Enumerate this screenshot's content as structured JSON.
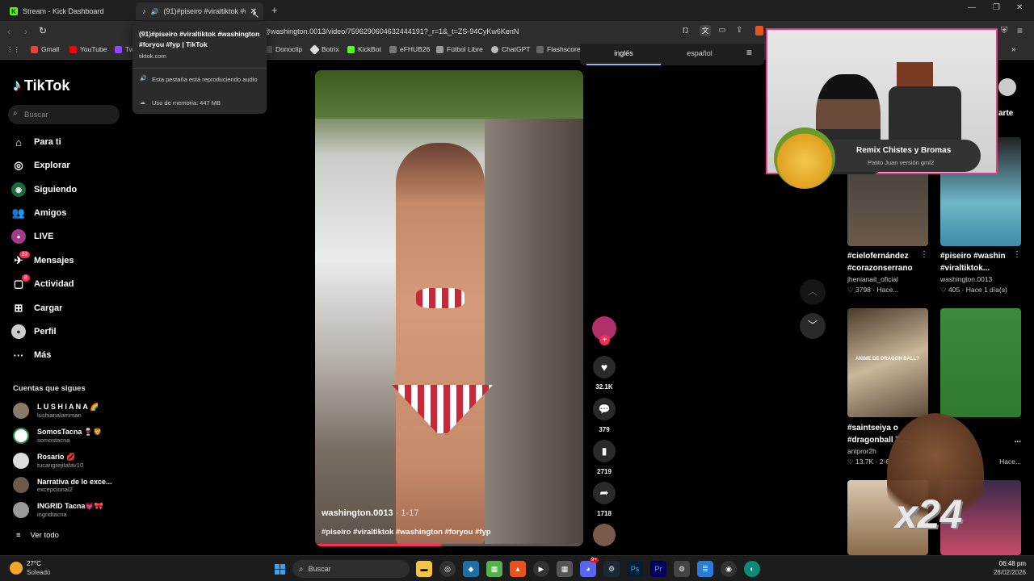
{
  "browser": {
    "tabs": [
      {
        "title": "Stream - Kick Dashboard"
      },
      {
        "title": "(91)#piseiro #viraltiktok #wa"
      }
    ],
    "url": "@washington.0013/video/7596290604632444191?_r=1&_t=ZS-94CyKw6KenN",
    "bookmarks": [
      "Gmail",
      "YouTube",
      "Tw",
      "Donoclip",
      "Botrix",
      "KickBot",
      "eFHUB26",
      "Fútbol Libre",
      "ChatGPT",
      "Flashscore"
    ],
    "tooltip": {
      "title": "(91)#piseiro #viraltiktok #washington #foryou #fyp | TikTok",
      "domain": "tiktok.com",
      "audio": "Esta pestaña está reproduciendo audio",
      "memory": "Uso de memoria: 447 MB"
    },
    "translate": {
      "lang1": "inglés",
      "lang2": "español"
    }
  },
  "tiktok": {
    "logo": "TikTok",
    "search_placeholder": "Buscar",
    "nav": [
      {
        "label": "Para ti",
        "icon": "home-icon"
      },
      {
        "label": "Explorar",
        "icon": "compass-icon"
      },
      {
        "label": "Siguiendo",
        "icon": "following-icon"
      },
      {
        "label": "Amigos",
        "icon": "friends-icon"
      },
      {
        "label": "LIVE",
        "icon": "live-icon"
      },
      {
        "label": "Mensajes",
        "icon": "messages-icon",
        "badge": "83"
      },
      {
        "label": "Actividad",
        "icon": "activity-icon",
        "badge": "8"
      },
      {
        "label": "Cargar",
        "icon": "upload-icon"
      },
      {
        "label": "Perfil",
        "icon": "profile-icon"
      },
      {
        "label": "Más",
        "icon": "more-icon"
      }
    ],
    "following_title": "Cuentas que sigues",
    "following": [
      {
        "name": "L U S H I A N A 🌈",
        "user": "lushianalamman"
      },
      {
        "name": "SomosTacna 🍷🦁",
        "user": "somostacna"
      },
      {
        "name": "Rosario 💋",
        "user": "tucangrejitafav10"
      },
      {
        "name": "Narrativa de lo exce...",
        "user": "excepcional2"
      },
      {
        "name": "INGRID Tacna💗🎀",
        "user": "ingridtacna"
      }
    ],
    "see_all": "Ver todo",
    "video": {
      "author": "washington.0013",
      "date": "· 1-17",
      "caption": "#piseiro #viraltiktok #washington #foryou #fyp",
      "likes": "32.1K",
      "comments": "379",
      "saves": "2719",
      "shares": "1718"
    },
    "share_label": "arte",
    "grid": [
      {
        "title1": "#cielofernández",
        "title2": "#corazonserrano",
        "user": "jhenianait_oficial",
        "likes": "3798",
        "time": "· Hace..."
      },
      {
        "title1": "#piseiro #washin",
        "title2": "#viraltiktok...",
        "user": "washington.0013",
        "likes": "405",
        "time": "· Hace 1 día(s)"
      },
      {
        "title1": "#saintseiya o",
        "title2": "#dragonball T...",
        "user": "anipror2h",
        "likes": "13.7K",
        "time": "· 2-6"
      },
      {
        "title1": "",
        "title2": "...",
        "user": "",
        "likes": "",
        "time": "Hace..."
      }
    ],
    "thumb_text": "ANIME DE DRAGON BALL?"
  },
  "overlay": {
    "title": "Remix Chistes y Bromas",
    "subtitle": "Patito Juan versión gml2",
    "multiplier": "x24"
  },
  "taskbar": {
    "weather_temp": "27°C",
    "weather_desc": "Soleado",
    "search": "Buscar",
    "time": "06:48 pm",
    "date": "28/02/2026",
    "discord_badge": "9+"
  }
}
